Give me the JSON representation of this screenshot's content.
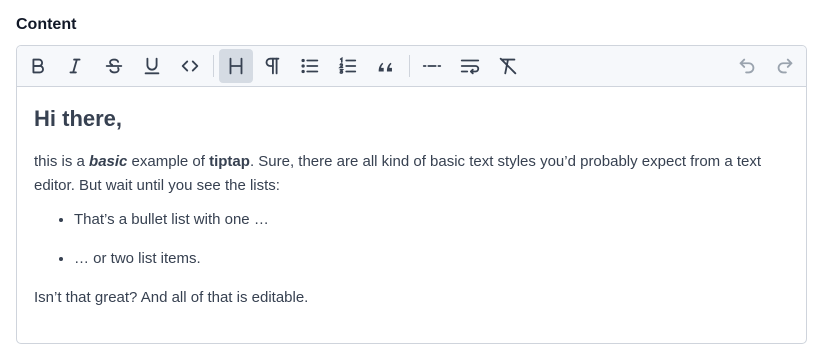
{
  "field": {
    "label": "Content"
  },
  "toolbar": {
    "buttons": [
      {
        "name": "bold",
        "icon": "bold-icon"
      },
      {
        "name": "italic",
        "icon": "italic-icon"
      },
      {
        "name": "strikethrough",
        "icon": "strikethrough-icon"
      },
      {
        "name": "underline",
        "icon": "underline-icon"
      },
      {
        "name": "code",
        "icon": "code-icon"
      },
      {
        "name": "heading",
        "icon": "heading-icon",
        "active": true
      },
      {
        "name": "paragraph",
        "icon": "paragraph-icon"
      },
      {
        "name": "bullet-list",
        "icon": "bullet-list-icon"
      },
      {
        "name": "ordered-list",
        "icon": "ordered-list-icon"
      },
      {
        "name": "blockquote",
        "icon": "quote-icon"
      },
      {
        "name": "horizontal-rule",
        "icon": "horizontal-rule-icon"
      },
      {
        "name": "hard-break",
        "icon": "text-wrap-icon"
      },
      {
        "name": "clear-format",
        "icon": "clear-format-icon"
      },
      {
        "name": "undo",
        "icon": "undo-icon",
        "disabled": true
      },
      {
        "name": "redo",
        "icon": "redo-icon",
        "disabled": true
      }
    ]
  },
  "content": {
    "heading": "Hi there,",
    "intro_1": "this is a ",
    "intro_basic": "basic",
    "intro_2": " example of ",
    "intro_tiptap": "tiptap",
    "intro_3": ". Sure, there are all kind of basic text styles you’d probably expect from a text editor. But wait until you see the lists:",
    "list": [
      "That’s a bullet list with one …",
      "… or two list items."
    ],
    "closing": "Isn’t that great? And all of that is editable."
  },
  "colors": {
    "toolbar_bg": "#f6f8fb",
    "border": "#cfd4dc",
    "active_bg": "#d5dbe3",
    "text": "#374151"
  }
}
